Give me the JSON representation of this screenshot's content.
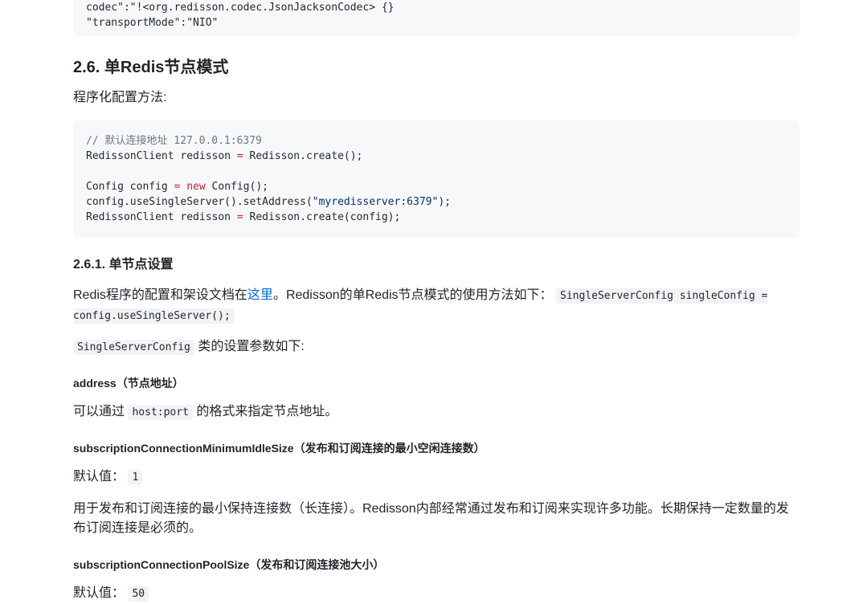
{
  "top_code": {
    "lines": [
      "codec\":\"!<org.redisson.codec.JsonJacksonCodec> {}",
      "\"transportMode\":\"NIO\""
    ]
  },
  "section": {
    "heading": "2.6. 单Redis节点模式",
    "intro": "程序化配置方法:",
    "code": {
      "comment": "// 默认连接地址 127.0.0.1:6379",
      "l1_a": "RedissonClient redisson ",
      "l1_op": "=",
      "l1_b": " Redisson.create();",
      "l3_a": "Config config ",
      "l3_op": "=",
      "l3_kw": "new",
      "l3_b": " Config();",
      "l4_a": "config.useSingleServer().setAddress(",
      "l4_str": "\"myredisserver:6379\"",
      "l4_b": ");",
      "l5_a": "RedissonClient redisson ",
      "l5_op": "=",
      "l5_b": " Redisson.create(config);"
    }
  },
  "subsection": {
    "heading": "2.6.1. 单节点设置",
    "para1_a": "Redis程序的配置和架设文档在",
    "para1_link": "这里",
    "para1_b": "。Redisson的单Redis节点模式的使用方法如下：",
    "para1_code": "SingleServerConfig singleConfig = config.useSingleServer();",
    "para2_code": "SingleServerConfig",
    "para2_text": " 类的设置参数如下:"
  },
  "params": [
    {
      "heading": "address（节点地址）",
      "text_a": "可以通过",
      "code": "host:port",
      "text_b": "的格式来指定节点地址。"
    },
    {
      "heading": "subscriptionConnectionMinimumIdleSize（发布和订阅连接的最小空闲连接数）",
      "default_label": "默认值：",
      "default_value": "1",
      "description": "用于发布和订阅连接的最小保持连接数（长连接）。Redisson内部经常通过发布和订阅来实现许多功能。长期保持一定数量的发布订阅连接是必须的。"
    },
    {
      "heading": "subscriptionConnectionPoolSize（发布和订阅连接池大小）",
      "default_label": "默认值：",
      "default_value": "50"
    }
  ]
}
